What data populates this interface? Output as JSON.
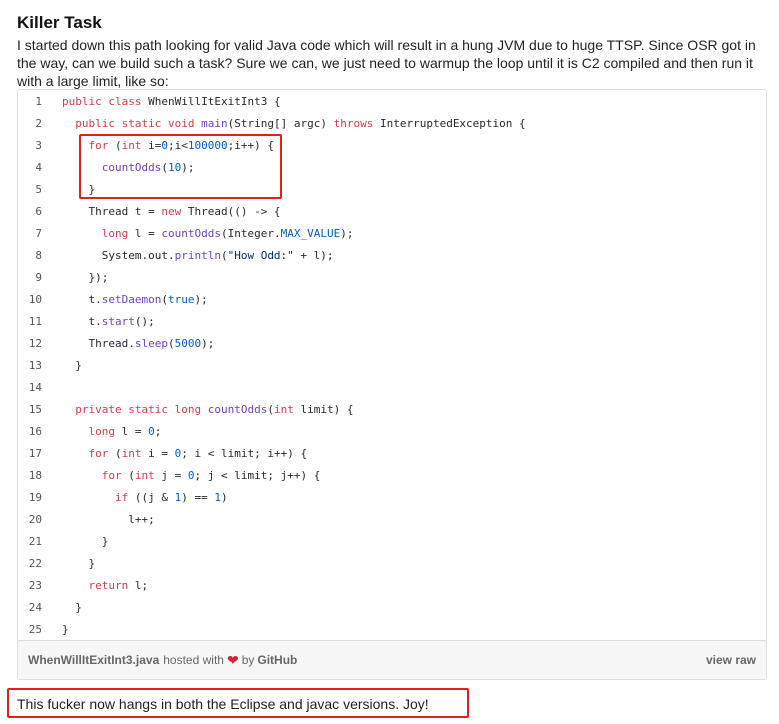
{
  "post": {
    "title": "Killer Task",
    "intro": "I started down this path looking for valid Java code which will result in a hung JVM due to huge TTSP. Since OSR got in the way, can we build such a task? Sure we can, we just need to warmup the loop until it is C2 compiled and then run it with a large limit, like so:",
    "closing": "This fucker now hangs in both the Eclipse and javac versions. Joy!"
  },
  "gist": {
    "filename": "WhenWillItExitInt3.java",
    "hosted_with": "hosted with",
    "by": "by",
    "host": "GitHub",
    "view_raw": "view raw",
    "lines": [
      {
        "n": "1",
        "text": "public class WhenWillItExitInt3 {"
      },
      {
        "n": "2",
        "text": "  public static void main(String[] argc) throws InterruptedException {"
      },
      {
        "n": "3",
        "text": "    for (int i=0;i<100000;i++) {"
      },
      {
        "n": "4",
        "text": "      countOdds(10);"
      },
      {
        "n": "5",
        "text": "    }"
      },
      {
        "n": "6",
        "text": "    Thread t = new Thread(() -> {"
      },
      {
        "n": "7",
        "text": "      long l = countOdds(Integer.MAX_VALUE);"
      },
      {
        "n": "8",
        "text": "      System.out.println(\"How Odd:\" + l);"
      },
      {
        "n": "9",
        "text": "    });"
      },
      {
        "n": "10",
        "text": "    t.setDaemon(true);"
      },
      {
        "n": "11",
        "text": "    t.start();"
      },
      {
        "n": "12",
        "text": "    Thread.sleep(5000);"
      },
      {
        "n": "13",
        "text": "  }"
      },
      {
        "n": "14",
        "text": ""
      },
      {
        "n": "15",
        "text": "  private static long countOdds(int limit) {"
      },
      {
        "n": "16",
        "text": "    long l = 0;"
      },
      {
        "n": "17",
        "text": "    for (int i = 0; i < limit; i++) {"
      },
      {
        "n": "18",
        "text": "      for (int j = 0; j < limit; j++) {"
      },
      {
        "n": "19",
        "text": "        if ((j & 1) == 1)"
      },
      {
        "n": "20",
        "text": "          l++;"
      },
      {
        "n": "21",
        "text": "      }"
      },
      {
        "n": "22",
        "text": "    }"
      },
      {
        "n": "23",
        "text": "    return l;"
      },
      {
        "n": "24",
        "text": "  }"
      },
      {
        "n": "25",
        "text": "}"
      }
    ]
  },
  "colors": {
    "keyword": "#d73a49",
    "function": "#6f42c1",
    "constant": "#005cc5",
    "highlight_box": "#e0201a",
    "heart": "#d1242f"
  },
  "icons": {
    "heart": "heart-icon"
  }
}
